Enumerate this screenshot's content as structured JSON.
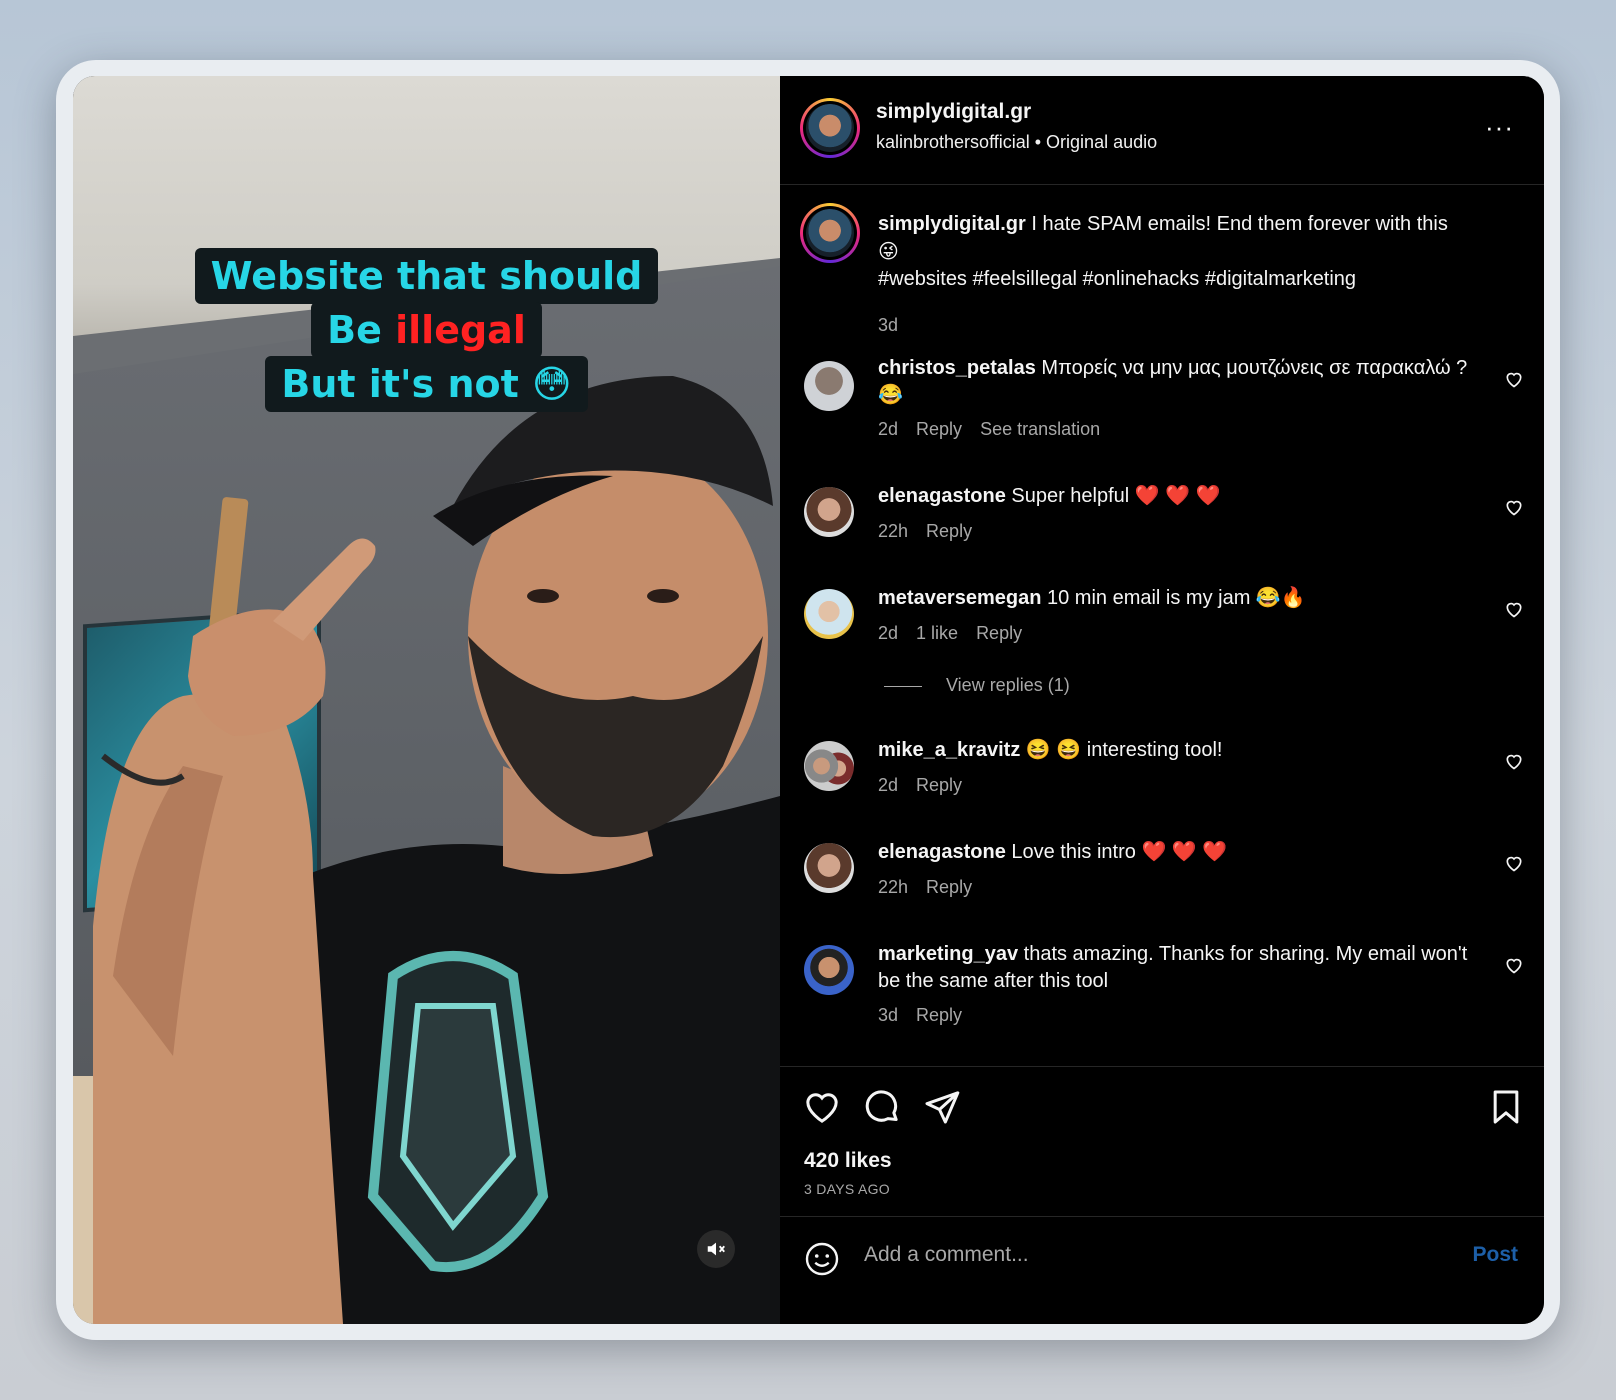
{
  "video": {
    "caption_line1": "Website that should",
    "caption_line2_a": "Be ",
    "caption_line2_b": "illegal",
    "caption_line3": "But it's not 😳",
    "mute_icon": "speaker-muted-icon"
  },
  "header": {
    "username": "simplydigital.gr",
    "subline": "kalinbrothersofficial • Original audio",
    "more": "···"
  },
  "post_caption": {
    "user": "simplydigital.gr",
    "text": " I hate SPAM emails! End them forever with this",
    "emoji": "😜",
    "hashtags": "#websites #feelsillegal #onlinehacks #digitalmarketing",
    "time": "3d"
  },
  "comments": [
    {
      "user": "christos_petalas",
      "text": " Μπορείς να μην μας μουτζώνεις σε παρακαλώ ? 😂",
      "time": "2d",
      "likes": "",
      "reply": "Reply",
      "translate": "See translation"
    },
    {
      "user": "elenagastone",
      "text": " Super helpful ❤️ ❤️ ❤️",
      "time": "22h",
      "likes": "",
      "reply": "Reply"
    },
    {
      "user": "metaversemegan",
      "text": " 10 min email is my jam 😂🔥",
      "time": "2d",
      "likes": "1 like",
      "reply": "Reply",
      "view_replies": "View replies (1)"
    },
    {
      "user": "mike_a_kravitz",
      "text": " 😆 😆  interesting tool!",
      "time": "2d",
      "likes": "",
      "reply": "Reply"
    },
    {
      "user": "elenagastone",
      "text": " Love this intro ❤️ ❤️ ❤️",
      "time": "22h",
      "likes": "",
      "reply": "Reply"
    },
    {
      "user": "marketing_yav",
      "text": " thats amazing. Thanks for sharing. My email won't be the same after this tool",
      "time": "3d",
      "likes": "",
      "reply": "Reply"
    }
  ],
  "actions": {
    "likes": "420 likes",
    "ago": "3 DAYS AGO"
  },
  "composer": {
    "placeholder": "Add a comment...",
    "post": "Post"
  },
  "colors": {
    "caption_text": "#27d6e6",
    "caption_highlight": "#ff2222",
    "post_button": "#1d5fa8",
    "panel_bg": "#000000"
  }
}
